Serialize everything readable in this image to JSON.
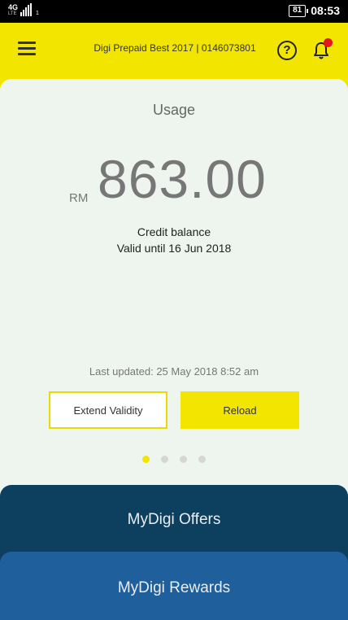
{
  "status_bar": {
    "network": "4G",
    "network_sub": "LTE",
    "sim": "1",
    "battery": "81",
    "time": "08:53",
    "icons": [
      "signal-icon",
      "battery-icon"
    ]
  },
  "header": {
    "account": "Digi Prepaid Best 2017 | 0146073801",
    "icons": [
      "menu-icon",
      "help-icon",
      "bell-icon"
    ]
  },
  "usage": {
    "title": "Usage",
    "currency": "RM",
    "amount": "863.00",
    "credit_label": "Credit balance",
    "valid_until": "Valid until 16 Jun 2018",
    "last_updated": "Last updated: 25 May 2018 8:52 am"
  },
  "actions": {
    "extend_label": "Extend Validity",
    "reload_label": "Reload"
  },
  "pager": {
    "count": 4,
    "active": 1
  },
  "panels": {
    "offers": "MyDigi Offers",
    "rewards": "MyDigi Rewards"
  },
  "colors": {
    "brand_yellow": "#f2e600",
    "offers_bg": "#0d3f5f",
    "rewards_bg": "#1f5f9b",
    "notification_dot": "#e4171b"
  }
}
